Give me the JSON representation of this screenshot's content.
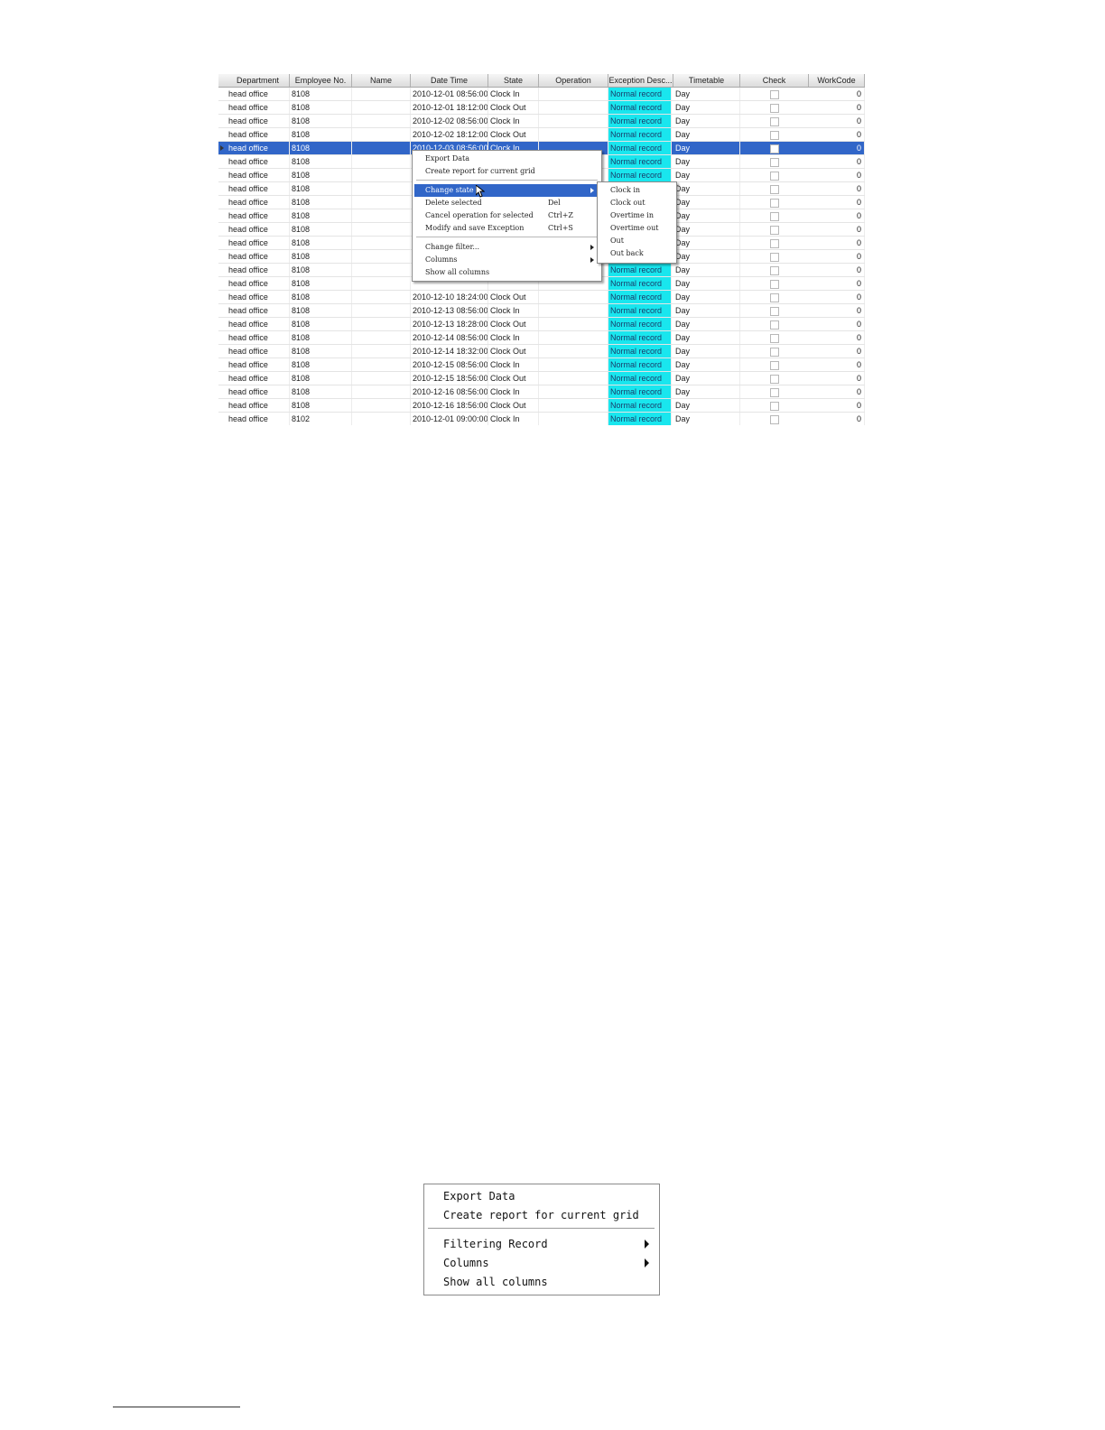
{
  "grid": {
    "columns": [
      "Department",
      "Employee No.",
      "Name",
      "Date Time",
      "State",
      "Operation",
      "Exception Desc...",
      "Timetable",
      "Check",
      "WorkCode"
    ],
    "selected_row": 4,
    "rows": [
      {
        "dept": "head office",
        "emp": "8108",
        "dt": "2010-12-01 08:56:00",
        "state": "Clock In",
        "exc": "Normal record",
        "tt": "Day",
        "wc": "0"
      },
      {
        "dept": "head office",
        "emp": "8108",
        "dt": "2010-12-01 18:12:00",
        "state": "Clock Out",
        "exc": "Normal record",
        "tt": "Day",
        "wc": "0"
      },
      {
        "dept": "head office",
        "emp": "8108",
        "dt": "2010-12-02 08:56:00",
        "state": "Clock In",
        "exc": "Normal record",
        "tt": "Day",
        "wc": "0"
      },
      {
        "dept": "head office",
        "emp": "8108",
        "dt": "2010-12-02 18:12:00",
        "state": "Clock Out",
        "exc": "Normal record",
        "tt": "Day",
        "wc": "0"
      },
      {
        "dept": "head office",
        "emp": "8108",
        "dt": "2010-12-03 08:56:00",
        "state": "Clock In",
        "exc": "Normal record",
        "tt": "Day",
        "wc": "0"
      },
      {
        "dept": "head office",
        "emp": "8108",
        "dt": "",
        "state": "",
        "exc": "Normal record",
        "tt": "Day",
        "wc": "0"
      },
      {
        "dept": "head office",
        "emp": "8108",
        "dt": "",
        "state": "",
        "exc": "Normal record",
        "tt": "Day",
        "wc": "0"
      },
      {
        "dept": "head office",
        "emp": "8108",
        "dt": "",
        "state": "",
        "exc": "",
        "tt": "Day",
        "wc": "0"
      },
      {
        "dept": "head office",
        "emp": "8108",
        "dt": "",
        "state": "",
        "exc": "",
        "tt": "Day",
        "wc": "0"
      },
      {
        "dept": "head office",
        "emp": "8108",
        "dt": "",
        "state": "",
        "exc": "",
        "tt": "Day",
        "wc": "0"
      },
      {
        "dept": "head office",
        "emp": "8108",
        "dt": "",
        "state": "",
        "exc": "",
        "tt": "Day",
        "wc": "0"
      },
      {
        "dept": "head office",
        "emp": "8108",
        "dt": "",
        "state": "",
        "exc": "",
        "tt": "Day",
        "wc": "0"
      },
      {
        "dept": "head office",
        "emp": "8108",
        "dt": "",
        "state": "",
        "exc": "",
        "tt": "Day",
        "wc": "0"
      },
      {
        "dept": "head office",
        "emp": "8108",
        "dt": "",
        "state": "",
        "exc": "Normal record",
        "tt": "Day",
        "wc": "0"
      },
      {
        "dept": "head office",
        "emp": "8108",
        "dt": "",
        "state": "",
        "exc": "Normal record",
        "tt": "Day",
        "wc": "0"
      },
      {
        "dept": "head office",
        "emp": "8108",
        "dt": "2010-12-10 18:24:00",
        "state": "Clock Out",
        "exc": "Normal record",
        "tt": "Day",
        "wc": "0"
      },
      {
        "dept": "head office",
        "emp": "8108",
        "dt": "2010-12-13 08:56:00",
        "state": "Clock In",
        "exc": "Normal record",
        "tt": "Day",
        "wc": "0"
      },
      {
        "dept": "head office",
        "emp": "8108",
        "dt": "2010-12-13 18:28:00",
        "state": "Clock Out",
        "exc": "Normal record",
        "tt": "Day",
        "wc": "0"
      },
      {
        "dept": "head office",
        "emp": "8108",
        "dt": "2010-12-14 08:56:00",
        "state": "Clock In",
        "exc": "Normal record",
        "tt": "Day",
        "wc": "0"
      },
      {
        "dept": "head office",
        "emp": "8108",
        "dt": "2010-12-14 18:32:00",
        "state": "Clock Out",
        "exc": "Normal record",
        "tt": "Day",
        "wc": "0"
      },
      {
        "dept": "head office",
        "emp": "8108",
        "dt": "2010-12-15 08:56:00",
        "state": "Clock In",
        "exc": "Normal record",
        "tt": "Day",
        "wc": "0"
      },
      {
        "dept": "head office",
        "emp": "8108",
        "dt": "2010-12-15 18:56:00",
        "state": "Clock Out",
        "exc": "Normal record",
        "tt": "Day",
        "wc": "0"
      },
      {
        "dept": "head office",
        "emp": "8108",
        "dt": "2010-12-16 08:56:00",
        "state": "Clock In",
        "exc": "Normal record",
        "tt": "Day",
        "wc": "0"
      },
      {
        "dept": "head office",
        "emp": "8108",
        "dt": "2010-12-16 18:56:00",
        "state": "Clock Out",
        "exc": "Normal record",
        "tt": "Day",
        "wc": "0"
      },
      {
        "dept": "head office",
        "emp": "8102",
        "dt": "2010-12-01 09:00:00",
        "state": "Clock In",
        "exc": "Normal record",
        "tt": "Day",
        "wc": "0"
      }
    ]
  },
  "context_menu": {
    "items": [
      {
        "label": "Export Data",
        "shortcut": "",
        "submenu": false
      },
      {
        "label": "Create report for current grid",
        "shortcut": "",
        "submenu": false
      },
      {
        "label": "Change state",
        "shortcut": "",
        "submenu": true,
        "highlighted": true
      },
      {
        "label": "Delete selected",
        "shortcut": "Del",
        "submenu": false
      },
      {
        "label": "Cancel operation for selected",
        "shortcut": "Ctrl+Z",
        "submenu": false
      },
      {
        "label": "Modify and save Exception",
        "shortcut": "Ctrl+S",
        "submenu": false
      },
      {
        "label": "Change filter...",
        "shortcut": "",
        "submenu": true
      },
      {
        "label": "Columns",
        "shortcut": "",
        "submenu": true
      },
      {
        "label": "Show all columns",
        "shortcut": "",
        "submenu": false
      }
    ]
  },
  "state_submenu": {
    "items": [
      "Clock in",
      "Clock out",
      "Overtime in",
      "Overtime out",
      "Out",
      "Out back"
    ]
  },
  "enlarged_menu": {
    "items": [
      {
        "label": "Export Data",
        "submenu": false
      },
      {
        "label": "Create report for current grid",
        "submenu": false
      },
      {
        "label": "Filtering Record",
        "submenu": true
      },
      {
        "label": "Columns",
        "submenu": true
      },
      {
        "label": "Show all columns",
        "submenu": false
      }
    ]
  },
  "colors": {
    "selection": "#3166c8",
    "exception_fill": "#19e6ee"
  }
}
